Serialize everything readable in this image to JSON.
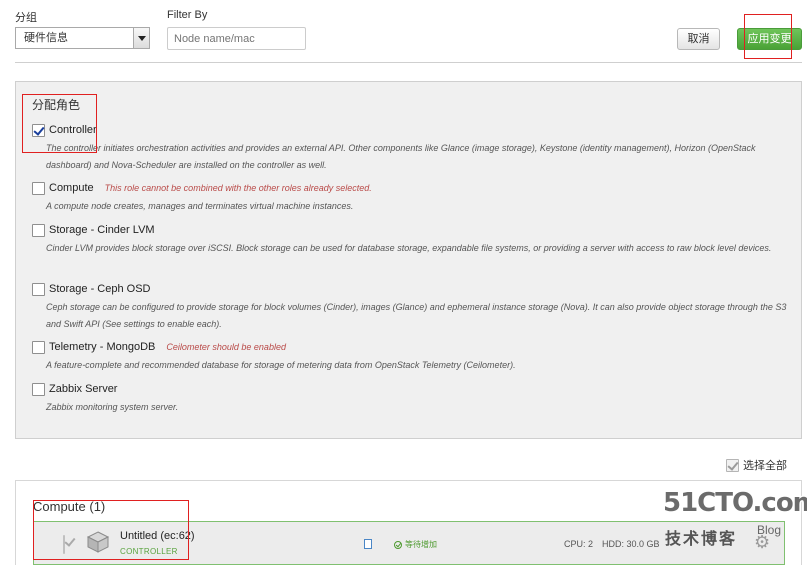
{
  "toolbar": {
    "group_label": "分组",
    "group_value": "硬件信息",
    "filter_label": "Filter By",
    "filter_placeholder": "Node name/mac",
    "cancel_label": "取消",
    "apply_label": "应用变更"
  },
  "roles_panel": {
    "title": "分配角色",
    "roles": [
      {
        "name": "Controller",
        "checked": true,
        "warning": "",
        "description": "The controller initiates orchestration activities and provides an external API. Other components like Glance (image storage), Keystone (identity management), Horizon (OpenStack dashboard) and Nova-Scheduler are installed on the controller as well."
      },
      {
        "name": "Compute",
        "checked": false,
        "warning": "This role cannot be combined with the other roles already selected.",
        "description": "A compute node creates, manages and terminates virtual machine instances."
      },
      {
        "name": "Storage - Cinder LVM",
        "checked": false,
        "warning": "",
        "description": "Cinder LVM provides block storage over iSCSI. Block storage can be used for database storage, expandable file systems, or providing a server with access to raw block level devices."
      },
      {
        "name": "Storage - Ceph OSD",
        "checked": false,
        "warning": "",
        "description": "Ceph storage can be configured to provide storage for block volumes (Cinder), images (Glance) and ephemeral instance storage (Nova). It can also provide object storage through the S3 and Swift API (See settings to enable each)."
      },
      {
        "name": "Telemetry - MongoDB",
        "checked": false,
        "warning": "Ceilometer should be enabled",
        "description": "A feature-complete and recommended database for storage of metering data from OpenStack Telemetry (Ceilometer)."
      },
      {
        "name": "Zabbix Server",
        "checked": false,
        "warning": "",
        "description": "Zabbix monitoring system server."
      }
    ]
  },
  "select_all_label": "选择全部",
  "compute_section": {
    "title": "Compute (1)",
    "node": {
      "name": "Untitled (ec:62)",
      "role": "CONTROLLER",
      "status": "等待增加",
      "cpu": "CPU: 2",
      "hdd": "HDD: 30.0 GB"
    }
  },
  "watermark": {
    "site": "51CTO.com",
    "tagline": "技术博客",
    "blog": "Blog"
  },
  "colors": {
    "apply_green": "#49a236",
    "annotation_red": "#e02020",
    "warning_red": "#b94a48",
    "role_green": "#5aa33f"
  }
}
